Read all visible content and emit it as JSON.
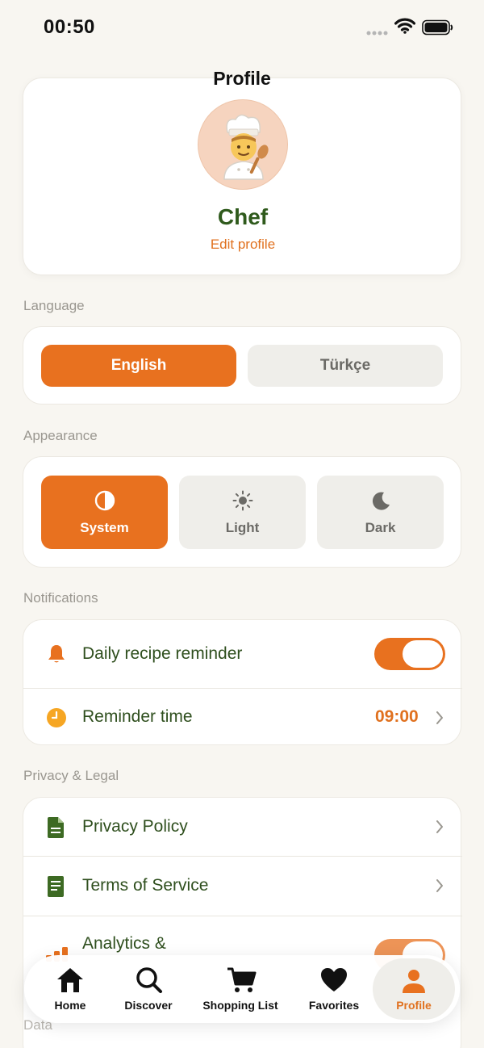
{
  "status_bar": {
    "time": "00:50"
  },
  "header": {
    "title": "Profile"
  },
  "profile": {
    "name": "Chef",
    "edit_label": "Edit profile",
    "avatar_emoji": "🧑‍🍳"
  },
  "language": {
    "section_label": "Language",
    "options": [
      "English",
      "Türkçe"
    ],
    "selected": "English"
  },
  "appearance": {
    "section_label": "Appearance",
    "options": [
      {
        "label": "System",
        "icon": "half-circle-icon"
      },
      {
        "label": "Light",
        "icon": "sun-icon"
      },
      {
        "label": "Dark",
        "icon": "moon-icon"
      }
    ],
    "selected": "System"
  },
  "notifications": {
    "section_label": "Notifications",
    "daily_reminder": {
      "label": "Daily recipe reminder",
      "enabled": true
    },
    "reminder_time": {
      "label": "Reminder time",
      "value": "09:00"
    }
  },
  "privacy": {
    "section_label": "Privacy & Legal",
    "items": [
      {
        "label": "Privacy Policy",
        "icon": "document-icon"
      },
      {
        "label": "Terms of Service",
        "icon": "document-icon"
      },
      {
        "label": "Analytics &",
        "icon": "chart-icon"
      }
    ]
  },
  "data_section": {
    "label": "Data"
  },
  "tabs": [
    {
      "label": "Home",
      "icon": "house-icon"
    },
    {
      "label": "Discover",
      "icon": "search-icon"
    },
    {
      "label": "Shopping List",
      "icon": "cart-icon"
    },
    {
      "label": "Favorites",
      "icon": "heart-icon"
    },
    {
      "label": "Profile",
      "icon": "person-icon",
      "active": true
    }
  ],
  "colors": {
    "accent": "#e8711f",
    "text_green": "#2f5a1c",
    "background": "#f8f6f1"
  }
}
